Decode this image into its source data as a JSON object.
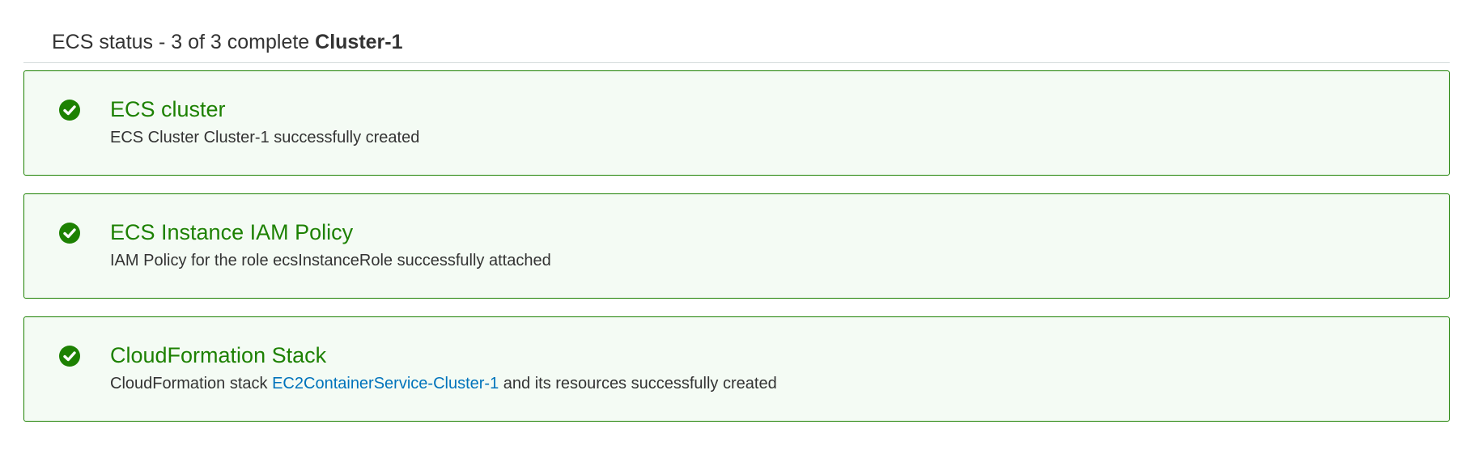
{
  "header": {
    "prefix": "ECS status - 3 of 3 complete",
    "cluster": "Cluster-1"
  },
  "steps": [
    {
      "title": "ECS cluster",
      "description": "ECS Cluster Cluster-1 successfully created",
      "status": "success",
      "icon": "check-circle-icon"
    },
    {
      "title": "ECS Instance IAM Policy",
      "description": "IAM Policy for the role ecsInstanceRole successfully attached",
      "status": "success",
      "icon": "check-circle-icon"
    },
    {
      "title": "CloudFormation Stack",
      "description_before": "CloudFormation stack",
      "link_text": "EC2ContainerService-Cluster-1",
      "description_after": "and its resources successfully created",
      "status": "success",
      "icon": "check-circle-icon"
    }
  ],
  "colors": {
    "success": "#1d8102",
    "success_background": "#f4fbf4",
    "link": "#0073bb",
    "text": "#333333",
    "divider": "#d5dbdb"
  }
}
